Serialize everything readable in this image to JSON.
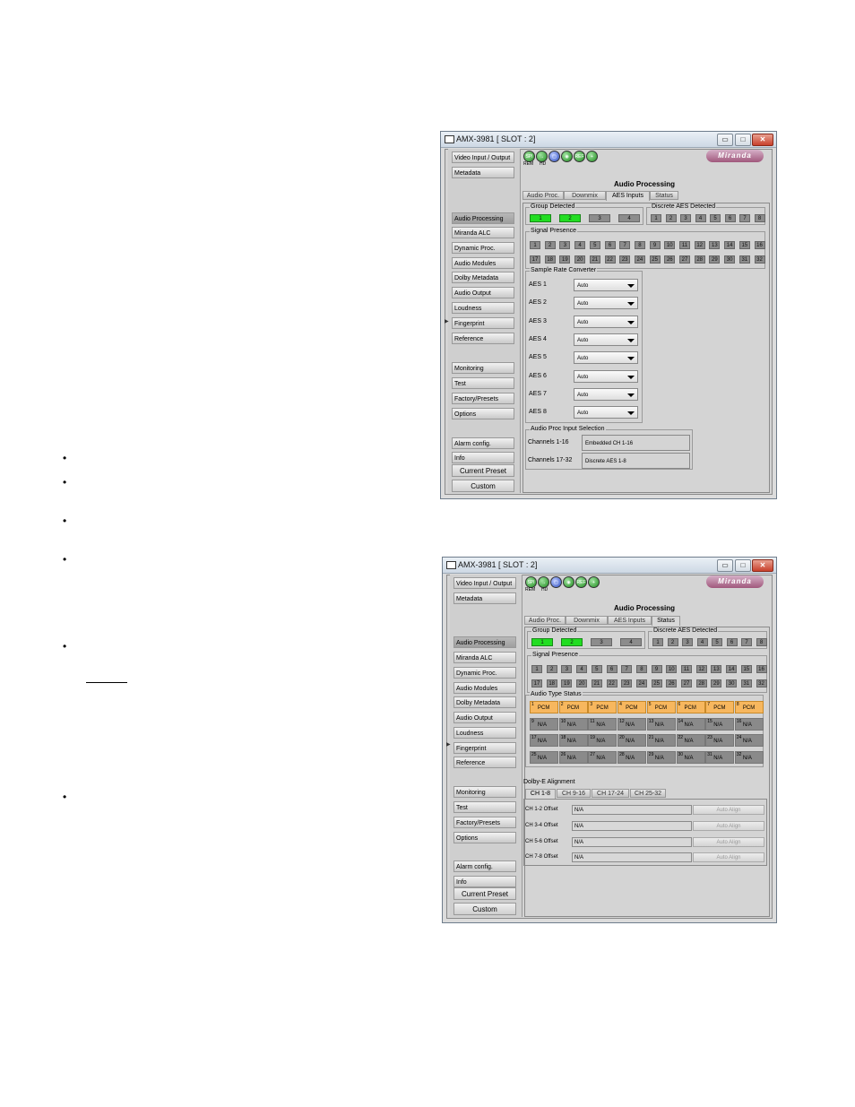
{
  "bullets": [
    "•",
    "•",
    "•",
    "•",
    "•",
    "•"
  ],
  "window_title": "AMX-3981 [ SLOT : 2]",
  "window_buttons": {
    "minimize": "▭",
    "maximize": "□",
    "close": "✕"
  },
  "logo": "Miranda",
  "tool_labels": {
    "rem": "REM",
    "hd": "HD"
  },
  "tool_icons": [
    "SPI",
    "→",
    "▢",
    "◉",
    "REF",
    "+"
  ],
  "nav_items": [
    "Video Input / Output",
    "Metadata",
    "Audio Processing",
    "Miranda ALC",
    "Dynamic Proc.",
    "Audio Modules",
    "Dolby Metadata",
    "Audio Output",
    "Loudness",
    "Fingerprint",
    "Reference",
    "Monitoring",
    "Test",
    "Factory/Presets",
    "Options",
    "Alarm config.",
    "Info"
  ],
  "nav_buttons": {
    "current_preset": "Current Preset",
    "custom": "Custom"
  },
  "main_title": "Audio Processing",
  "tabs": [
    "Audio Proc.",
    "Downmix",
    "AES Inputs",
    "Status"
  ],
  "group_detected": {
    "label": "Group Detected",
    "cells": [
      "1",
      "2",
      "3",
      "4"
    ],
    "on": [
      true,
      true,
      false,
      false
    ]
  },
  "discrete_aes": {
    "label": "Discrete AES Detected",
    "cells": [
      "1",
      "2",
      "3",
      "4",
      "5",
      "6",
      "7",
      "8"
    ]
  },
  "signal_presence": {
    "label": "Signal Presence",
    "row1": [
      "1",
      "2",
      "3",
      "4",
      "5",
      "6",
      "7",
      "8",
      "9",
      "10",
      "11",
      "12",
      "13",
      "14",
      "15",
      "16"
    ],
    "row2": [
      "17",
      "18",
      "19",
      "20",
      "21",
      "22",
      "23",
      "24",
      "25",
      "26",
      "27",
      "28",
      "29",
      "30",
      "31",
      "32"
    ]
  },
  "src": {
    "label": "Sample Rate Converter",
    "rows": [
      {
        "name": "AES 1",
        "value": "Auto"
      },
      {
        "name": "AES 2",
        "value": "Auto"
      },
      {
        "name": "AES 3",
        "value": "Auto"
      },
      {
        "name": "AES 4",
        "value": "Auto"
      },
      {
        "name": "AES 5",
        "value": "Auto"
      },
      {
        "name": "AES 6",
        "value": "Auto"
      },
      {
        "name": "AES 7",
        "value": "Auto"
      },
      {
        "name": "AES 8",
        "value": "Auto"
      }
    ]
  },
  "input_selection": {
    "label": "Audio Proc Input Selection",
    "rows": [
      {
        "name": "Channels 1-16",
        "value": "Embedded CH 1-16"
      },
      {
        "name": "Channels 17-32",
        "value": "Discrete AES 1-8"
      }
    ]
  },
  "audio_type": {
    "label": "Audio Type Status",
    "items": [
      {
        "n": "1",
        "v": "PCM"
      },
      {
        "n": "2",
        "v": "PCM"
      },
      {
        "n": "3",
        "v": "PCM"
      },
      {
        "n": "4",
        "v": "PCM"
      },
      {
        "n": "5",
        "v": "PCM"
      },
      {
        "n": "6",
        "v": "PCM"
      },
      {
        "n": "7",
        "v": "PCM"
      },
      {
        "n": "8",
        "v": "PCM"
      },
      {
        "n": "9",
        "v": "N/A"
      },
      {
        "n": "10",
        "v": "N/A"
      },
      {
        "n": "11",
        "v": "N/A"
      },
      {
        "n": "12",
        "v": "N/A"
      },
      {
        "n": "13",
        "v": "N/A"
      },
      {
        "n": "14",
        "v": "N/A"
      },
      {
        "n": "15",
        "v": "N/A"
      },
      {
        "n": "16",
        "v": "N/A"
      },
      {
        "n": "17",
        "v": "N/A"
      },
      {
        "n": "18",
        "v": "N/A"
      },
      {
        "n": "19",
        "v": "N/A"
      },
      {
        "n": "20",
        "v": "N/A"
      },
      {
        "n": "21",
        "v": "N/A"
      },
      {
        "n": "22",
        "v": "N/A"
      },
      {
        "n": "23",
        "v": "N/A"
      },
      {
        "n": "24",
        "v": "N/A"
      },
      {
        "n": "25",
        "v": "N/A"
      },
      {
        "n": "26",
        "v": "N/A"
      },
      {
        "n": "27",
        "v": "N/A"
      },
      {
        "n": "28",
        "v": "N/A"
      },
      {
        "n": "29",
        "v": "N/A"
      },
      {
        "n": "30",
        "v": "N/A"
      },
      {
        "n": "31",
        "v": "N/A"
      },
      {
        "n": "32",
        "v": "N/A"
      }
    ]
  },
  "dolby_e": {
    "label": "Dolby-E Alignment",
    "tabs": [
      "CH 1-8",
      "CH 9-16",
      "CH 17-24",
      "CH 25-32"
    ],
    "rows": [
      {
        "name": "CH 1-2 Offset",
        "value": "N/A",
        "button": "Auto Align"
      },
      {
        "name": "CH 3-4 Offset",
        "value": "N/A",
        "button": "Auto Align"
      },
      {
        "name": "CH 5-6 Offset",
        "value": "N/A",
        "button": "Auto Align"
      },
      {
        "name": "CH 7-8 Offset",
        "value": "N/A",
        "button": "Auto Align"
      }
    ]
  },
  "colors": {
    "green": "#22dd22",
    "pcm": "#f7b75e",
    "na": "#8a8a8a"
  }
}
